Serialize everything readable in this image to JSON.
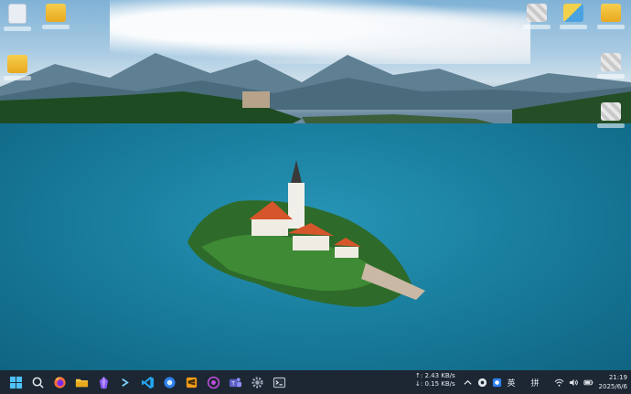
{
  "desktop": {
    "wallpaper_description_colors": {
      "sky": "#a9cbe3",
      "lake": "#1a7f9f",
      "forest": "#1f4b22",
      "roof": "#d6562b"
    },
    "icons_left": [
      {
        "id": "icon-1",
        "glyph": "doc-icon"
      },
      {
        "id": "icon-2",
        "glyph": "folder-icon"
      },
      {
        "id": "icon-3",
        "glyph": "folder-icon"
      }
    ],
    "icons_right": [
      {
        "id": "icon-4",
        "glyph": "pixel-icon"
      },
      {
        "id": "icon-5",
        "glyph": "folder-icon"
      },
      {
        "id": "icon-6",
        "glyph": "folder-icon"
      },
      {
        "id": "icon-7",
        "glyph": "pixel-icon"
      },
      {
        "id": "icon-8",
        "glyph": "pixel-icon"
      }
    ]
  },
  "taskbar": {
    "apps": [
      {
        "name": "start-button",
        "icon": "windows-logo-icon"
      },
      {
        "name": "search-button",
        "icon": "search-icon"
      },
      {
        "name": "firefox-button",
        "icon": "firefox-icon"
      },
      {
        "name": "file-explorer-button",
        "icon": "folder-icon"
      },
      {
        "name": "obsidian-button",
        "icon": "obsidian-icon"
      },
      {
        "name": "powershell-button",
        "icon": "terminal-prompt-icon"
      },
      {
        "name": "vscode-button",
        "icon": "vscode-icon"
      },
      {
        "name": "app-blue-button",
        "icon": "blue-circle-icon"
      },
      {
        "name": "sublime-button",
        "icon": "sublime-icon"
      },
      {
        "name": "media-button",
        "icon": "record-icon"
      },
      {
        "name": "teams-button",
        "icon": "teams-icon"
      },
      {
        "name": "settings-button",
        "icon": "gear-icon"
      },
      {
        "name": "terminal-button",
        "icon": "terminal-icon"
      }
    ],
    "network": {
      "upload": "↑: 2.43 KB/s",
      "download": "↓: 0.15 KB/s"
    },
    "tray": {
      "ime_english": "英",
      "ime_pinyin": "拼"
    },
    "clock": {
      "time": "21:19",
      "date": "2025/6/6"
    }
  }
}
